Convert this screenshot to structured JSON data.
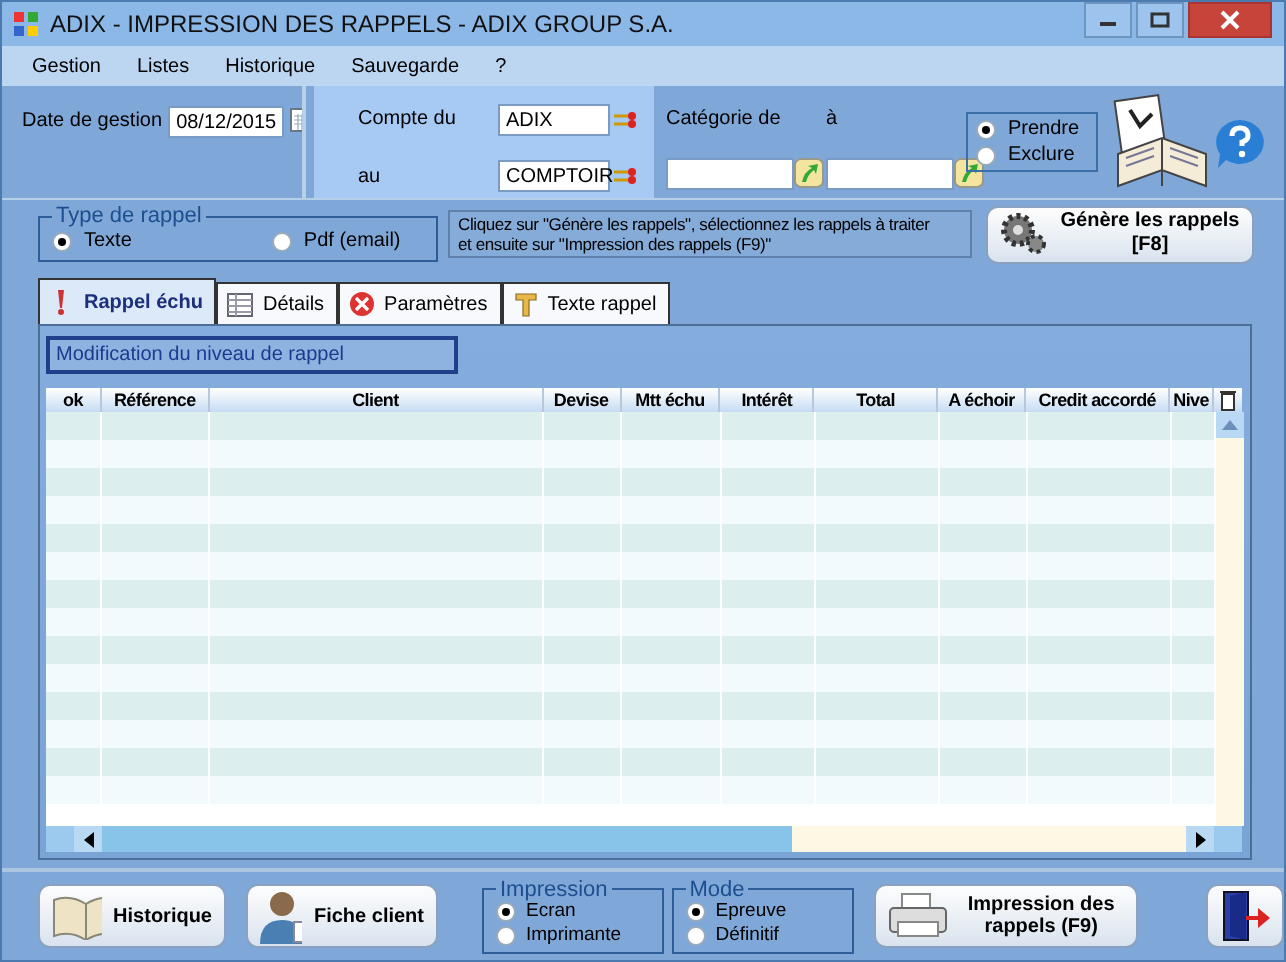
{
  "window": {
    "title": "ADIX - IMPRESSION DES RAPPELS - ADIX GROUP S.A."
  },
  "menu": [
    "Gestion",
    "Listes",
    "Historique",
    "Sauvegarde",
    "?"
  ],
  "date": {
    "label": "Date de gestion",
    "value": "08/12/2015"
  },
  "compte": {
    "from_label": "Compte du",
    "from_value": "ADIX",
    "to_label": "au",
    "to_value": "COMPTOIR"
  },
  "categorie": {
    "from_label": "Catégorie de",
    "to_label": "à"
  },
  "filter": [
    {
      "label": "Prendre",
      "selected": true
    },
    {
      "label": "Exclure",
      "selected": false
    }
  ],
  "type_rappel": {
    "title": "Type de rappel",
    "options": [
      {
        "label": "Texte",
        "selected": true
      },
      {
        "label": "Pdf (email)",
        "selected": false
      }
    ]
  },
  "hint": "Cliquez sur \"Génère les rappels\", sélectionnez les rappels à traiter\net ensuite sur \"Impression des rappels (F9)\"",
  "generate_button": {
    "label": "Génère les rappels",
    "shortcut": "[F8]"
  },
  "tabs": [
    {
      "label": "Rappel échu",
      "selected": true
    },
    {
      "label": "Détails",
      "selected": false
    },
    {
      "label": "Paramètres",
      "selected": false
    },
    {
      "label": "Texte rappel",
      "selected": false
    }
  ],
  "panel_title": "Modification du niveau de rappel",
  "table": {
    "columns": [
      "ok",
      "Référence",
      "Client",
      "Devise",
      "Mtt échu",
      "Intérêt",
      "Total",
      "A échoir",
      "Credit accordé",
      "Nive"
    ]
  },
  "buttons": {
    "history": "Historique",
    "client": "Fiche client",
    "print": "Impression des rappels (F9)"
  },
  "impression": {
    "title": "Impression",
    "options": [
      {
        "label": "Ecran",
        "selected": true
      },
      {
        "label": "Imprimante",
        "selected": false
      }
    ]
  },
  "mode": {
    "title": "Mode",
    "options": [
      {
        "label": "Epreuve",
        "selected": true
      },
      {
        "label": "Définitif",
        "selected": false
      }
    ]
  }
}
